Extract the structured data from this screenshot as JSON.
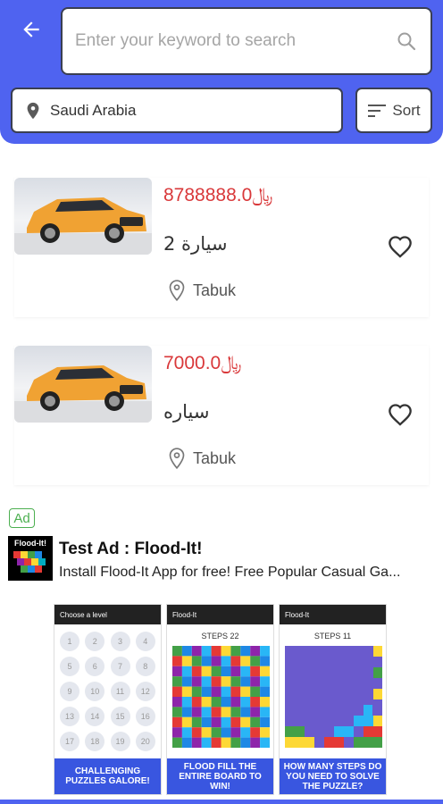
{
  "header": {
    "search": {
      "placeholder": "Enter your keyword to search"
    },
    "location": "Saudi Arabia",
    "sort_label": "Sort"
  },
  "listings": [
    {
      "price": "8788888.0",
      "currency": "﷼",
      "title": "سيارة 2",
      "location": "Tabuk"
    },
    {
      "price": "7000.0",
      "currency": "﷼",
      "title": "سياره",
      "location": "Tabuk"
    }
  ],
  "ad": {
    "badge": "Ad",
    "icon_text": "Flood-It!",
    "title": "Test Ad : Flood-It!",
    "description": "Install Flood-It App for free! Free Popular Casual Ga...",
    "screenshots": [
      {
        "bar": "Choose a level",
        "caption": "CHALLENGING PUZZLES GALORE!"
      },
      {
        "bar": "Flood-It",
        "steps": "STEPS 22",
        "caption": "FLOOD FILL THE ENTIRE BOARD TO WIN!"
      },
      {
        "bar": "Flood-It",
        "steps": "STEPS 11",
        "caption": "HOW MANY STEPS DO YOU NEED TO SOLVE THE PUZZLE?"
      }
    ],
    "levels": [
      "1",
      "2",
      "3",
      "4",
      "5",
      "6",
      "7",
      "8",
      "9",
      "10",
      "11",
      "12",
      "13",
      "14",
      "15",
      "16",
      "17",
      "18",
      "19",
      "20"
    ]
  },
  "colors": {
    "primary": "#4f63f0",
    "price": "#d9383a",
    "ad_green": "#4caf50"
  }
}
